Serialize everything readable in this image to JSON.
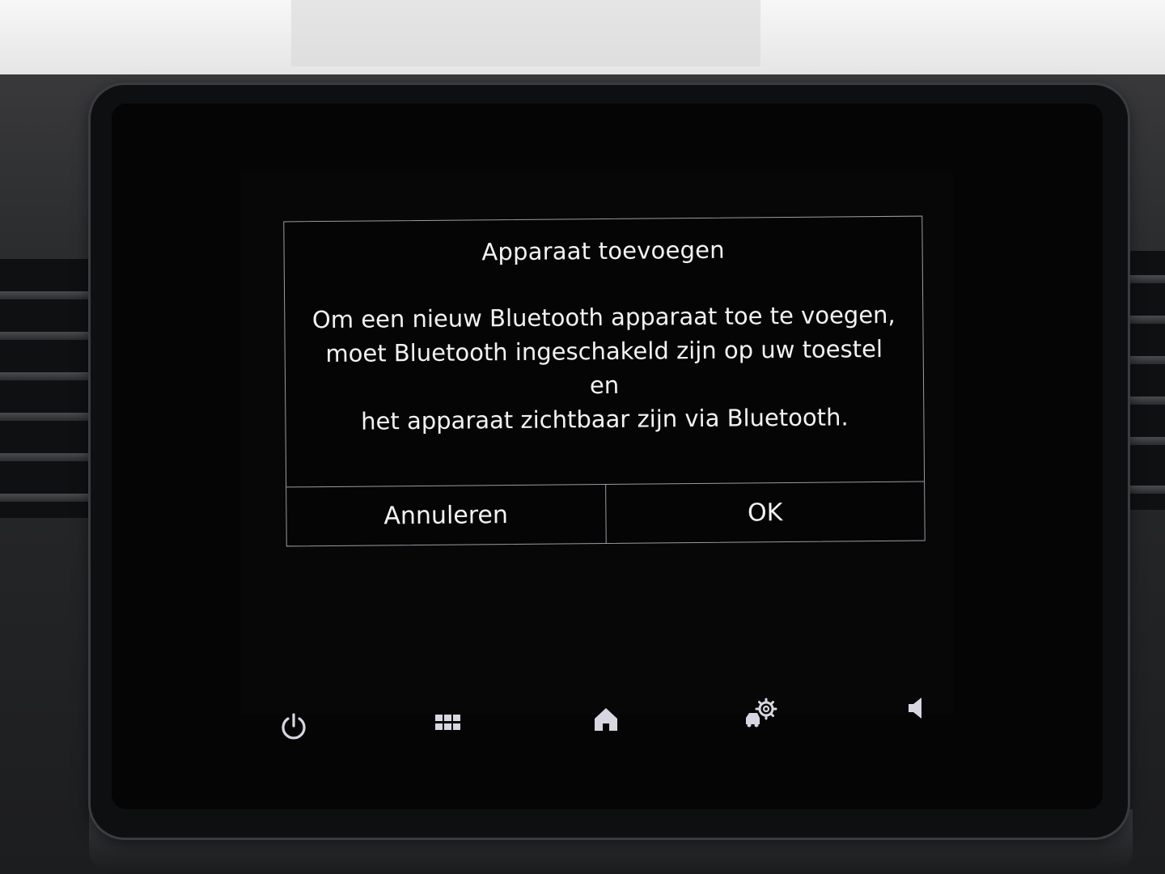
{
  "dialog": {
    "title": "Apparaat toevoegen",
    "message_lines": [
      "Om een nieuw Bluetooth apparaat toe te voegen,",
      "moet Bluetooth ingeschakeld zijn op uw toestel en",
      "het apparaat zichtbaar zijn via Bluetooth."
    ],
    "cancel_label": "Annuleren",
    "ok_label": "OK"
  },
  "softkeys": [
    {
      "icon": "power-icon"
    },
    {
      "icon": "apps-grid-icon"
    },
    {
      "icon": "home-icon"
    },
    {
      "icon": "vehicle-settings-icon"
    },
    {
      "icon": "volume-icon"
    }
  ],
  "colors": {
    "dialog_border": "#9c9aa6",
    "text": "#f2f2f2",
    "icon": "#d8d6e0",
    "screen": "#050505"
  }
}
